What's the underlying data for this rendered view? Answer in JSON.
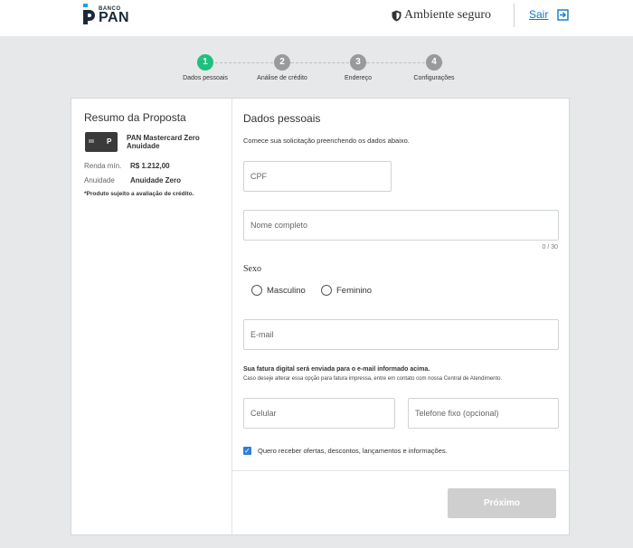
{
  "header": {
    "logo_small": "BANCO",
    "logo_big": "PAN",
    "secure_label": "Ambiente seguro",
    "exit_label": "Sair"
  },
  "steps": [
    {
      "number": "1",
      "label": "Dados pessoais",
      "active": true
    },
    {
      "number": "2",
      "label": "Análise de crédito",
      "active": false
    },
    {
      "number": "3",
      "label": "Endereço",
      "active": false
    },
    {
      "number": "4",
      "label": "Configurações",
      "active": false
    }
  ],
  "summary": {
    "title": "Resumo da Proposta",
    "card_name": "PAN Mastercard Zero Anuidade",
    "income_label": "Renda mín.",
    "income_value": "R$ 1.212,00",
    "fee_label": "Anuidade",
    "fee_value": "Anuidade Zero",
    "note": "*Produto sujeito a avaliação de crédito."
  },
  "form": {
    "title": "Dados pessoais",
    "subtitle": "Comece sua solicitação preenchendo os dados abaixo.",
    "cpf_placeholder": "CPF",
    "name_placeholder": "Nome completo",
    "name_counter": "0 / 30",
    "sexo_label": "Sexo",
    "option_male": "Masculino",
    "option_female": "Feminino",
    "email_placeholder": "E-mail",
    "invoice_note": "Sua fatura digital será enviada para o e-mail informado acima.",
    "invoice_subnote": "Caso deseje alterar essa opção para fatura impressa, entre em contato com nossa Central de Atendimento.",
    "mobile_placeholder": "Celular",
    "phone_placeholder": "Telefone fixo (opcional)",
    "offers_label": "Quero receber ofertas, descontos, lançamentos e informações.",
    "offers_checked": true,
    "next_label": "Próximo"
  },
  "colors": {
    "active_step": "#1fbf7f",
    "inactive_step": "#9a9a9a",
    "link": "#0b78c5",
    "checkbox": "#2f7ed8",
    "disabled_button": "#cfcfcf"
  }
}
